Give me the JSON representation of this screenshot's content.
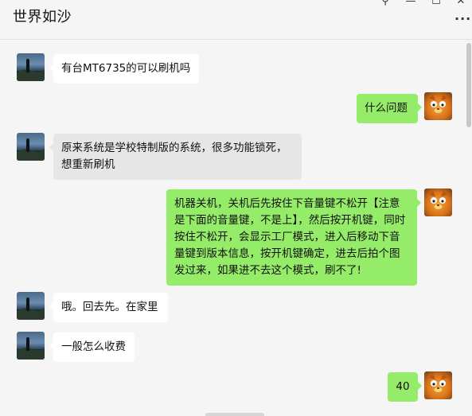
{
  "window": {
    "title": "世界如沙",
    "pin_icon": "⚲",
    "minimize_icon": "—",
    "maximize_icon": "☐",
    "close_icon": "✕",
    "more_icon": "···"
  },
  "colors": {
    "background": "#f5f5f5",
    "incoming_bubble": "#ffffff",
    "incoming_bubble_selected": "#e6e6e6",
    "outgoing_bubble": "#95ec69"
  },
  "messages": [
    {
      "sender": "other",
      "avatar": "landscape-avatar",
      "text": "有台MT6735的可以刷机吗"
    },
    {
      "sender": "self",
      "avatar": "orange-cat-avatar",
      "text": "什么问题"
    },
    {
      "sender": "other",
      "avatar": "landscape-avatar",
      "text": "原来系统是学校特制版的系统，很多功能锁死，想重新刷机"
    },
    {
      "sender": "self",
      "avatar": "orange-cat-avatar",
      "text": "机器关机，关机后先按住下音量键不松开【注意是下面的音量键，不是上】，然后按开机键，同时按住不松开，会显示工厂模式，进入后移动下音量键到版本信息，按开机键确定，进去后拍个图发过来，如果进不去这个模式，刷不了!"
    },
    {
      "sender": "other",
      "avatar": "landscape-avatar",
      "text": "哦。回去先。在家里"
    },
    {
      "sender": "other",
      "avatar": "landscape-avatar",
      "text": "一般怎么收费"
    },
    {
      "sender": "self",
      "avatar": "orange-cat-avatar",
      "text": "40"
    }
  ]
}
